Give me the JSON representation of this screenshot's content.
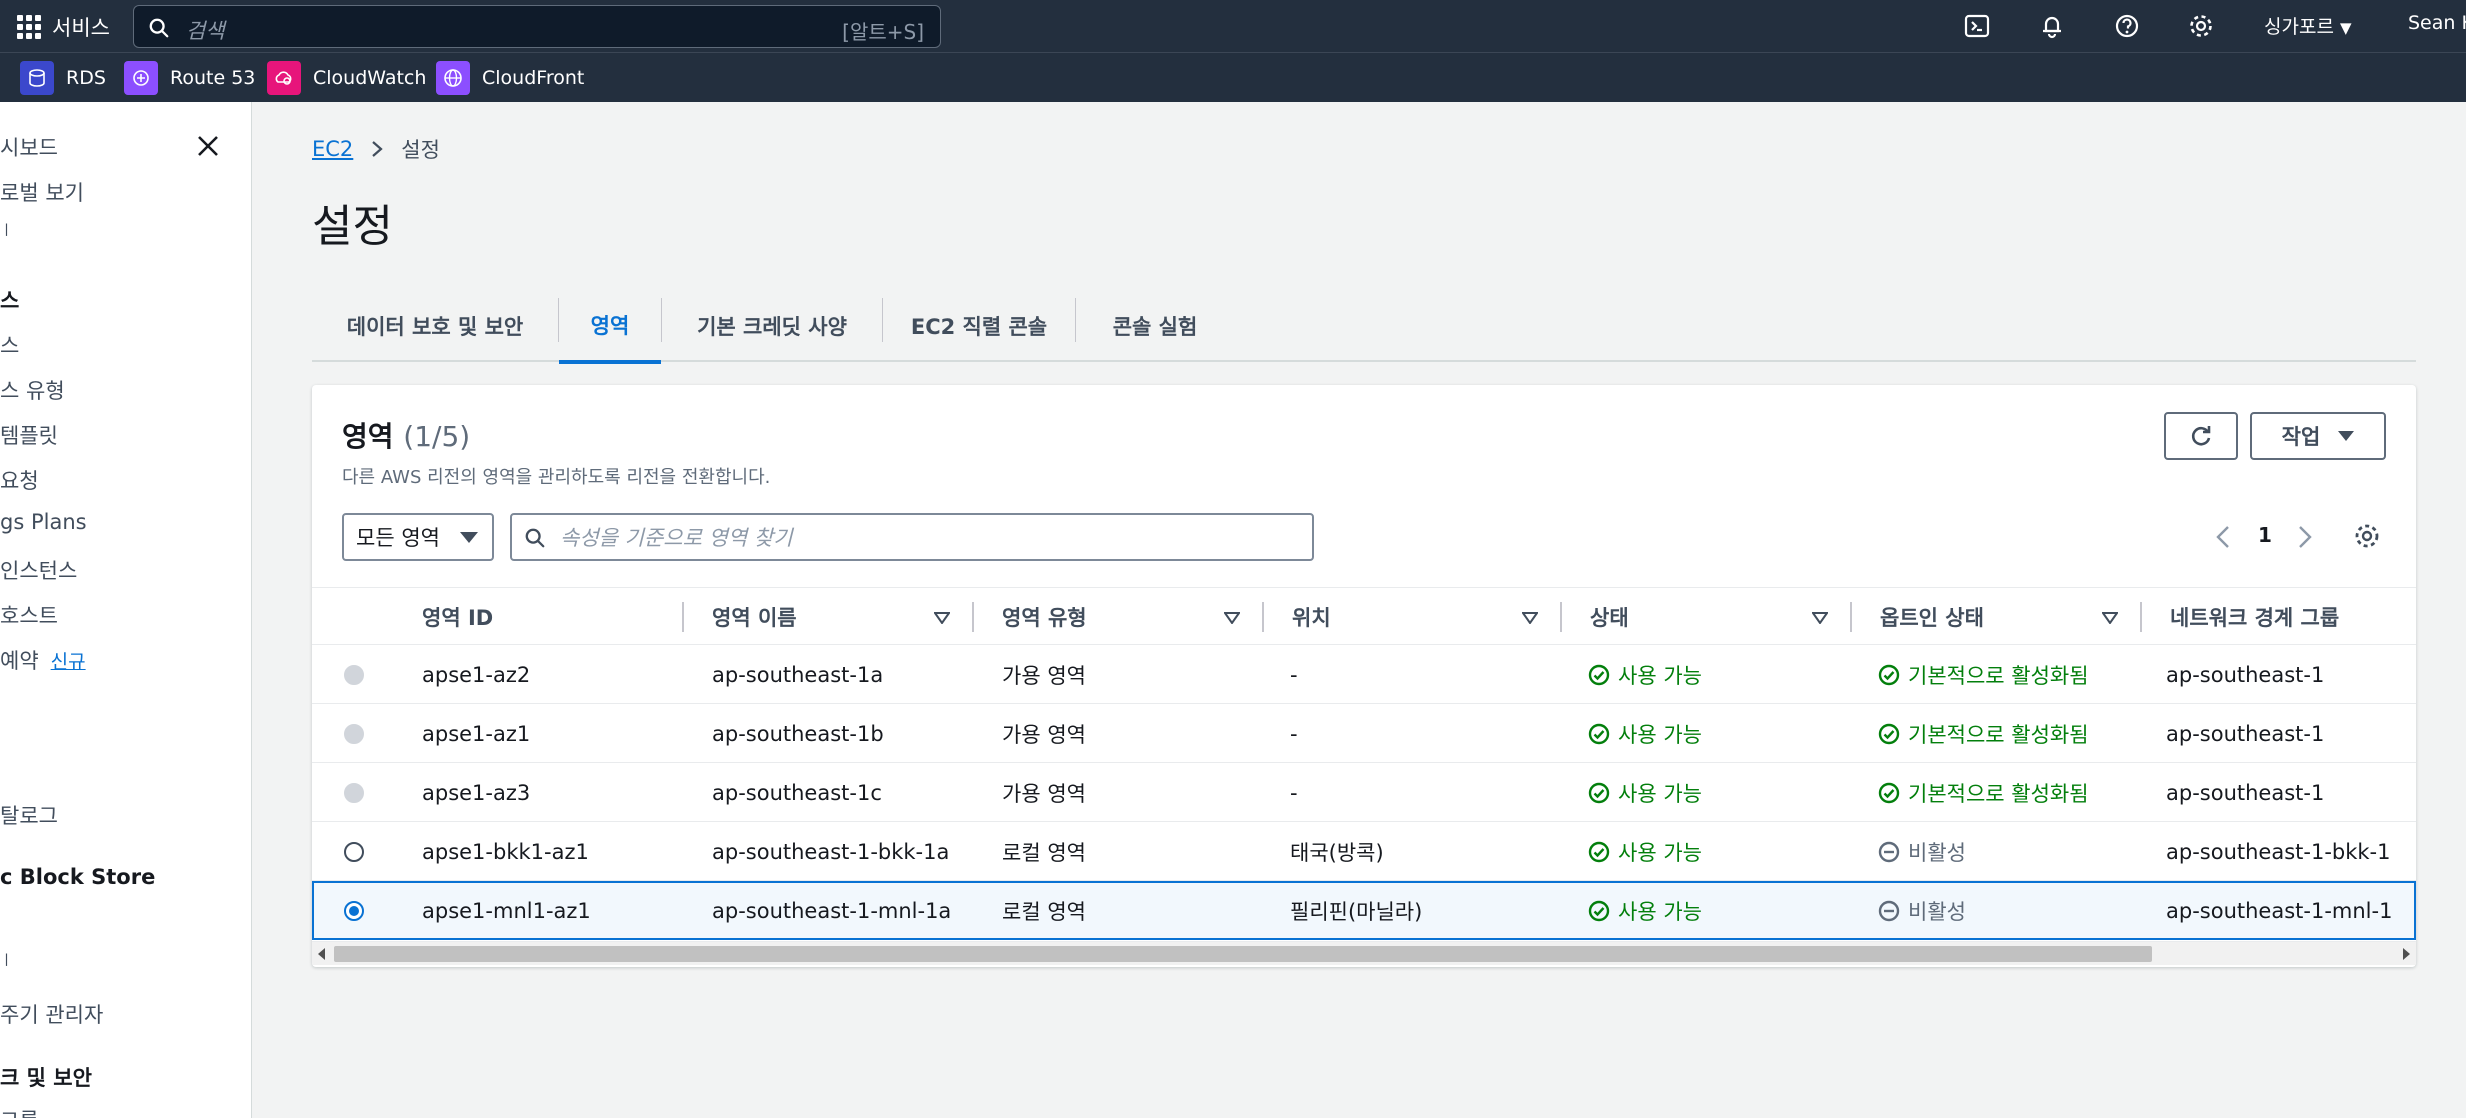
{
  "topnav": {
    "services_label": "서비스",
    "search_placeholder": "검색",
    "search_shortcut": "[알트+S]",
    "region": "싱가포르",
    "user": "Sean K"
  },
  "favorites": [
    {
      "label": "RDS",
      "color": "#3b48cc"
    },
    {
      "label": "Route 53",
      "color": "#8c4fff"
    },
    {
      "label": "CloudWatch",
      "color": "#e7157b"
    },
    {
      "label": "CloudFront",
      "color": "#8c4fff"
    }
  ],
  "sidebar": {
    "items": [
      {
        "label": "시보드"
      },
      {
        "label": "로벌 보기"
      },
      {
        "label": "ㅣ"
      },
      {
        "label": "스"
      },
      {
        "label": "스"
      },
      {
        "label": "스 유형"
      },
      {
        "label": "템플릿"
      },
      {
        "label": "요청"
      },
      {
        "label": "gs Plans"
      },
      {
        "label": "인스턴스"
      },
      {
        "label": "호스트"
      },
      {
        "label": "예약",
        "new_badge": "신규"
      },
      {
        "label": "탈로그"
      },
      {
        "label": "c Block Store"
      },
      {
        "label": "ㅣ"
      },
      {
        "label": "주기 관리자"
      },
      {
        "label": "크 및 보안"
      },
      {
        "label": "그룹"
      }
    ]
  },
  "breadcrumb": {
    "root": "EC2",
    "current": "설정"
  },
  "page_title": "설정",
  "tabs": [
    {
      "label": "데이터 보호 및 보안",
      "active": false
    },
    {
      "label": "영역",
      "active": true
    },
    {
      "label": "기본 크레딧 사양",
      "active": false
    },
    {
      "label": "EC2 직렬 콘솔",
      "active": false
    },
    {
      "label": "콘솔 실험",
      "active": false
    }
  ],
  "panel": {
    "title": "영역",
    "count": "(1/5)",
    "description": "다른 AWS 리전의 영역을 관리하도록 리전을 전환합니다.",
    "action_label": "작업",
    "filter_select": "모든 영역",
    "filter_placeholder": "속성을 기준으로 영역 찾기",
    "page_number": "1"
  },
  "table": {
    "columns": [
      "영역 ID",
      "영역 이름",
      "영역 유형",
      "위치",
      "상태",
      "옵트인 상태",
      "네트워크 경계 그룹"
    ],
    "rows": [
      {
        "id": "apse1-az2",
        "name": "ap-southeast-1a",
        "type": "가용 영역",
        "location": "-",
        "status": "사용 가능",
        "optin": "기본적으로 활성화됨",
        "optin_ok": true,
        "group": "ap-southeast-1",
        "radio": "disabled"
      },
      {
        "id": "apse1-az1",
        "name": "ap-southeast-1b",
        "type": "가용 영역",
        "location": "-",
        "status": "사용 가능",
        "optin": "기본적으로 활성화됨",
        "optin_ok": true,
        "group": "ap-southeast-1",
        "radio": "disabled"
      },
      {
        "id": "apse1-az3",
        "name": "ap-southeast-1c",
        "type": "가용 영역",
        "location": "-",
        "status": "사용 가능",
        "optin": "기본적으로 활성화됨",
        "optin_ok": true,
        "group": "ap-southeast-1",
        "radio": "disabled"
      },
      {
        "id": "apse1-bkk1-az1",
        "name": "ap-southeast-1-bkk-1a",
        "type": "로컬 영역",
        "location": "태국(방콕)",
        "status": "사용 가능",
        "optin": "비활성",
        "optin_ok": false,
        "group": "ap-southeast-1-bkk-1",
        "radio": "enabled"
      },
      {
        "id": "apse1-mnl1-az1",
        "name": "ap-southeast-1-mnl-1a",
        "type": "로컬 영역",
        "location": "필리핀(마닐라)",
        "status": "사용 가능",
        "optin": "비활성",
        "optin_ok": false,
        "group": "ap-southeast-1-mnl-1",
        "radio": "checked"
      }
    ]
  }
}
